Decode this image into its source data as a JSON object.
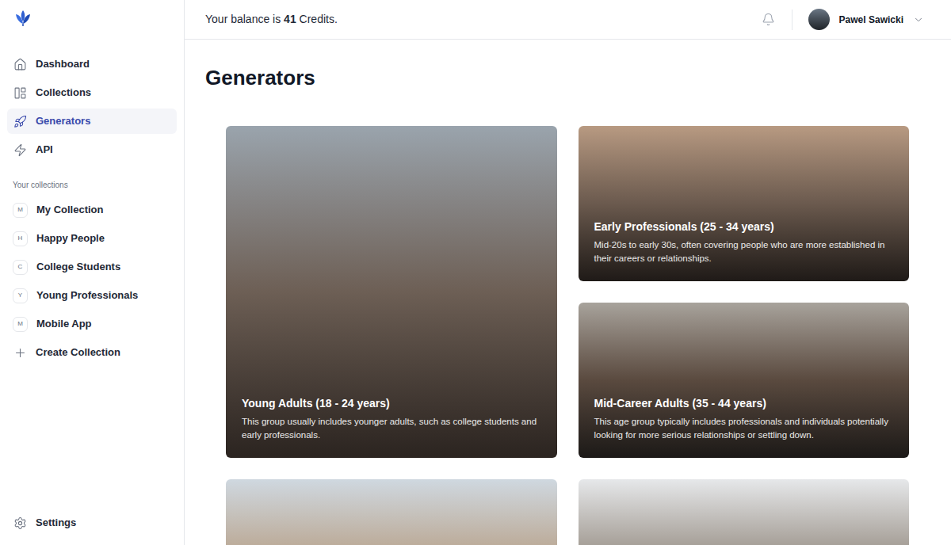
{
  "topbar": {
    "balance_prefix": "Your balance is ",
    "balance_value": "41",
    "balance_suffix": " Credits.",
    "user": {
      "name": "Pawel Sawicki"
    }
  },
  "sidebar": {
    "nav": [
      {
        "label": "Dashboard",
        "icon": "home",
        "selected": false
      },
      {
        "label": "Collections",
        "icon": "collections",
        "selected": false
      },
      {
        "label": "Generators",
        "icon": "rocket",
        "selected": true
      },
      {
        "label": "API",
        "icon": "bolt",
        "selected": false
      }
    ],
    "collections_heading": "Your collections",
    "collections": [
      {
        "initial": "M",
        "label": "My Collection"
      },
      {
        "initial": "H",
        "label": "Happy People"
      },
      {
        "initial": "C",
        "label": "College Students"
      },
      {
        "initial": "Y",
        "label": "Young Professionals"
      },
      {
        "initial": "M",
        "label": "Mobile App"
      }
    ],
    "create": "Create Collection",
    "settings": "Settings"
  },
  "page": {
    "title": "Generators"
  },
  "cards": [
    {
      "kind": "captioned",
      "title": "Young Adults (18 - 24 years)",
      "description": "This group usually includes younger adults, such as college students and early professionals."
    },
    {
      "kind": "captioned",
      "title": "Early Professionals (25 - 34 years)",
      "description": "Mid-20s to early 30s, often covering people who are more established in their careers or relationships."
    },
    {
      "kind": "captioned",
      "title": "Mid-Career Adults (35 - 44 years)",
      "description": "This age group typically includes professionals and individuals potentially looking for more serious relationships or settling down."
    },
    {
      "kind": "photo"
    },
    {
      "kind": "photo"
    }
  ]
}
